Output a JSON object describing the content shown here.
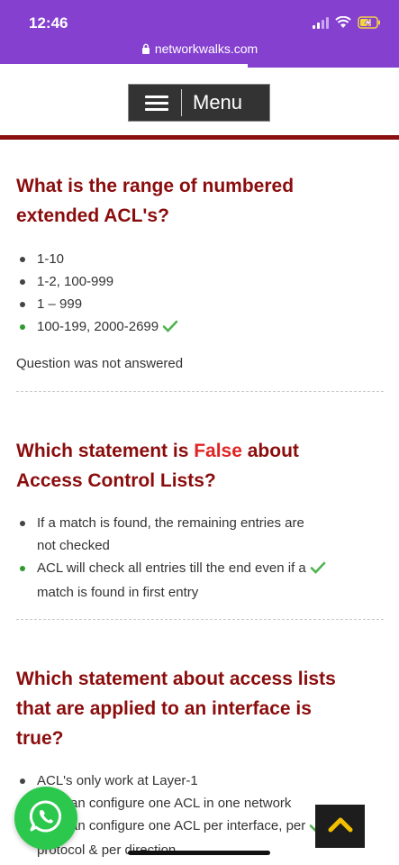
{
  "status_bar": {
    "time": "12:46",
    "url": "networkwalks.com"
  },
  "menu": {
    "label": "Menu"
  },
  "questions": [
    {
      "title_line1": "What is the range of numbered",
      "title_line2": "extended ACL's?",
      "options": [
        "1-10",
        "1-2, 100-999",
        "1 – 999",
        "100-199, 2000-2699"
      ],
      "correct_index": 3,
      "note": "Question was not answered"
    },
    {
      "title_pre": "Which statement is ",
      "title_false": "False",
      "title_post": " about",
      "title_line2": "Access Control Lists?",
      "options": [
        {
          "line1": "If a match is found, the remaining entries are",
          "line2": "not checked"
        },
        {
          "line1": "ACL will check all entries till the end even if a",
          "line2": "match is found in first entry"
        }
      ],
      "correct_index": 1
    },
    {
      "title_line1": "Which statement about access lists",
      "title_line2": "that are applied to an interface is",
      "title_line3": "true?",
      "options": [
        "ACL's only work at Layer-1",
        "You can configure one ACL in one network",
        "You can configure one ACL per interface, per",
        "protocol & per direction"
      ],
      "correct_index": 2
    }
  ],
  "colors": {
    "accent": "#8540d0",
    "heading": "#8b0c0c",
    "false_word": "#e02424",
    "correct": "#2e9a2e"
  },
  "icons": [
    "lock-icon",
    "signal-icon",
    "wifi-icon",
    "battery-charging-icon",
    "hamburger-icon",
    "check-icon",
    "whatsapp-icon",
    "chevron-up-icon"
  ]
}
